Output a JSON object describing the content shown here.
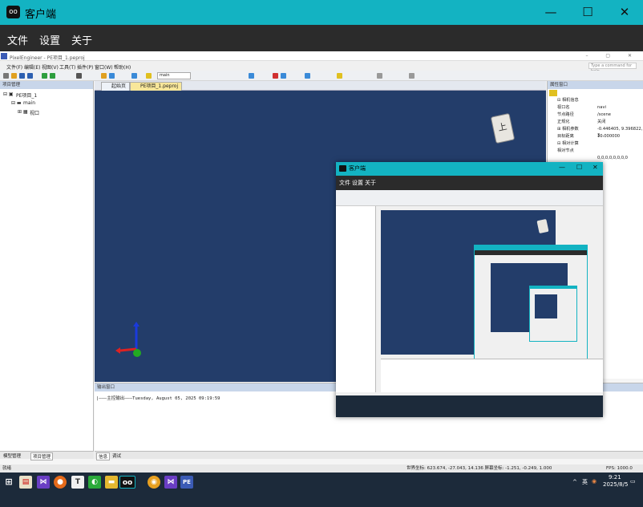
{
  "app": {
    "title": "客户端"
  },
  "window_buttons": {
    "minimize": "—",
    "maximize": "☐",
    "close": "✕"
  },
  "menu": [
    "文件",
    "设置",
    "关于"
  ],
  "pe": {
    "title": "PixelEngineer - PE项目_1.peproj",
    "menu": [
      "文件(F)",
      "编辑(E)",
      "视图(V)",
      "工具(T)",
      "插件(P)",
      "窗口(W)",
      "帮助(H)"
    ],
    "command_placeholder": "Type a command for help",
    "toolbar_select": "main",
    "left_panel": {
      "title": "项目管理",
      "tree": [
        "PE项目_1",
        "main",
        "视口"
      ],
      "tabs": [
        "模型管理",
        "项目管理"
      ]
    },
    "doc_tabs": [
      "起始页",
      "PE项目_1.peproj"
    ],
    "view_cube_label": "上",
    "right_panel": {
      "title": "属性窗口",
      "rows": [
        {
          "k": "⊟ 相机信息",
          "v": ""
        },
        {
          "k": "视口名",
          "v": "navi"
        },
        {
          "k": "节点路径",
          "v": "/scene"
        },
        {
          "k": "正规化",
          "v": "关闭"
        },
        {
          "k": "⊞ 相机参数",
          "v": "-0.446405, 9.396822, 3..."
        },
        {
          "k": "目标距离",
          "v": "10.000000"
        },
        {
          "k": "⊟ 相对计算",
          "v": ""
        },
        {
          "k": "相对节点",
          "v": ""
        },
        {
          "k": "",
          "v": "0,0,0,0,0,0,0,0"
        }
      ]
    },
    "output": {
      "title": "输出窗口",
      "line": "|———主控输出———Tuesday, August 05, 2025 09:19:59",
      "tabs": [
        "信息",
        "调试"
      ]
    },
    "status": {
      "left": "就绪",
      "coords": "世界坐标: 623.674, -27.043, 14.136  屏幕坐标: -1.251, -0.249, 1.000",
      "fps": "FPS: 1000.0"
    }
  },
  "nested": {
    "title": "客户端",
    "menu": [
      "文件",
      "设置",
      "关于"
    ]
  },
  "taskbar": {
    "time": "9:21",
    "date": "2025/8/5",
    "lang": "英",
    "icons": [
      "start-icon",
      "file-icon",
      "vs-icon",
      "firefox-icon",
      "typora-icon",
      "wechat-icon",
      "explorer-icon",
      "client-icon",
      "chrome-icon",
      "vs2-icon",
      "pe-icon"
    ]
  },
  "colors": {
    "accent": "#13b3c2",
    "viewport": "#233d6a",
    "menubar": "#2b2b2b"
  }
}
